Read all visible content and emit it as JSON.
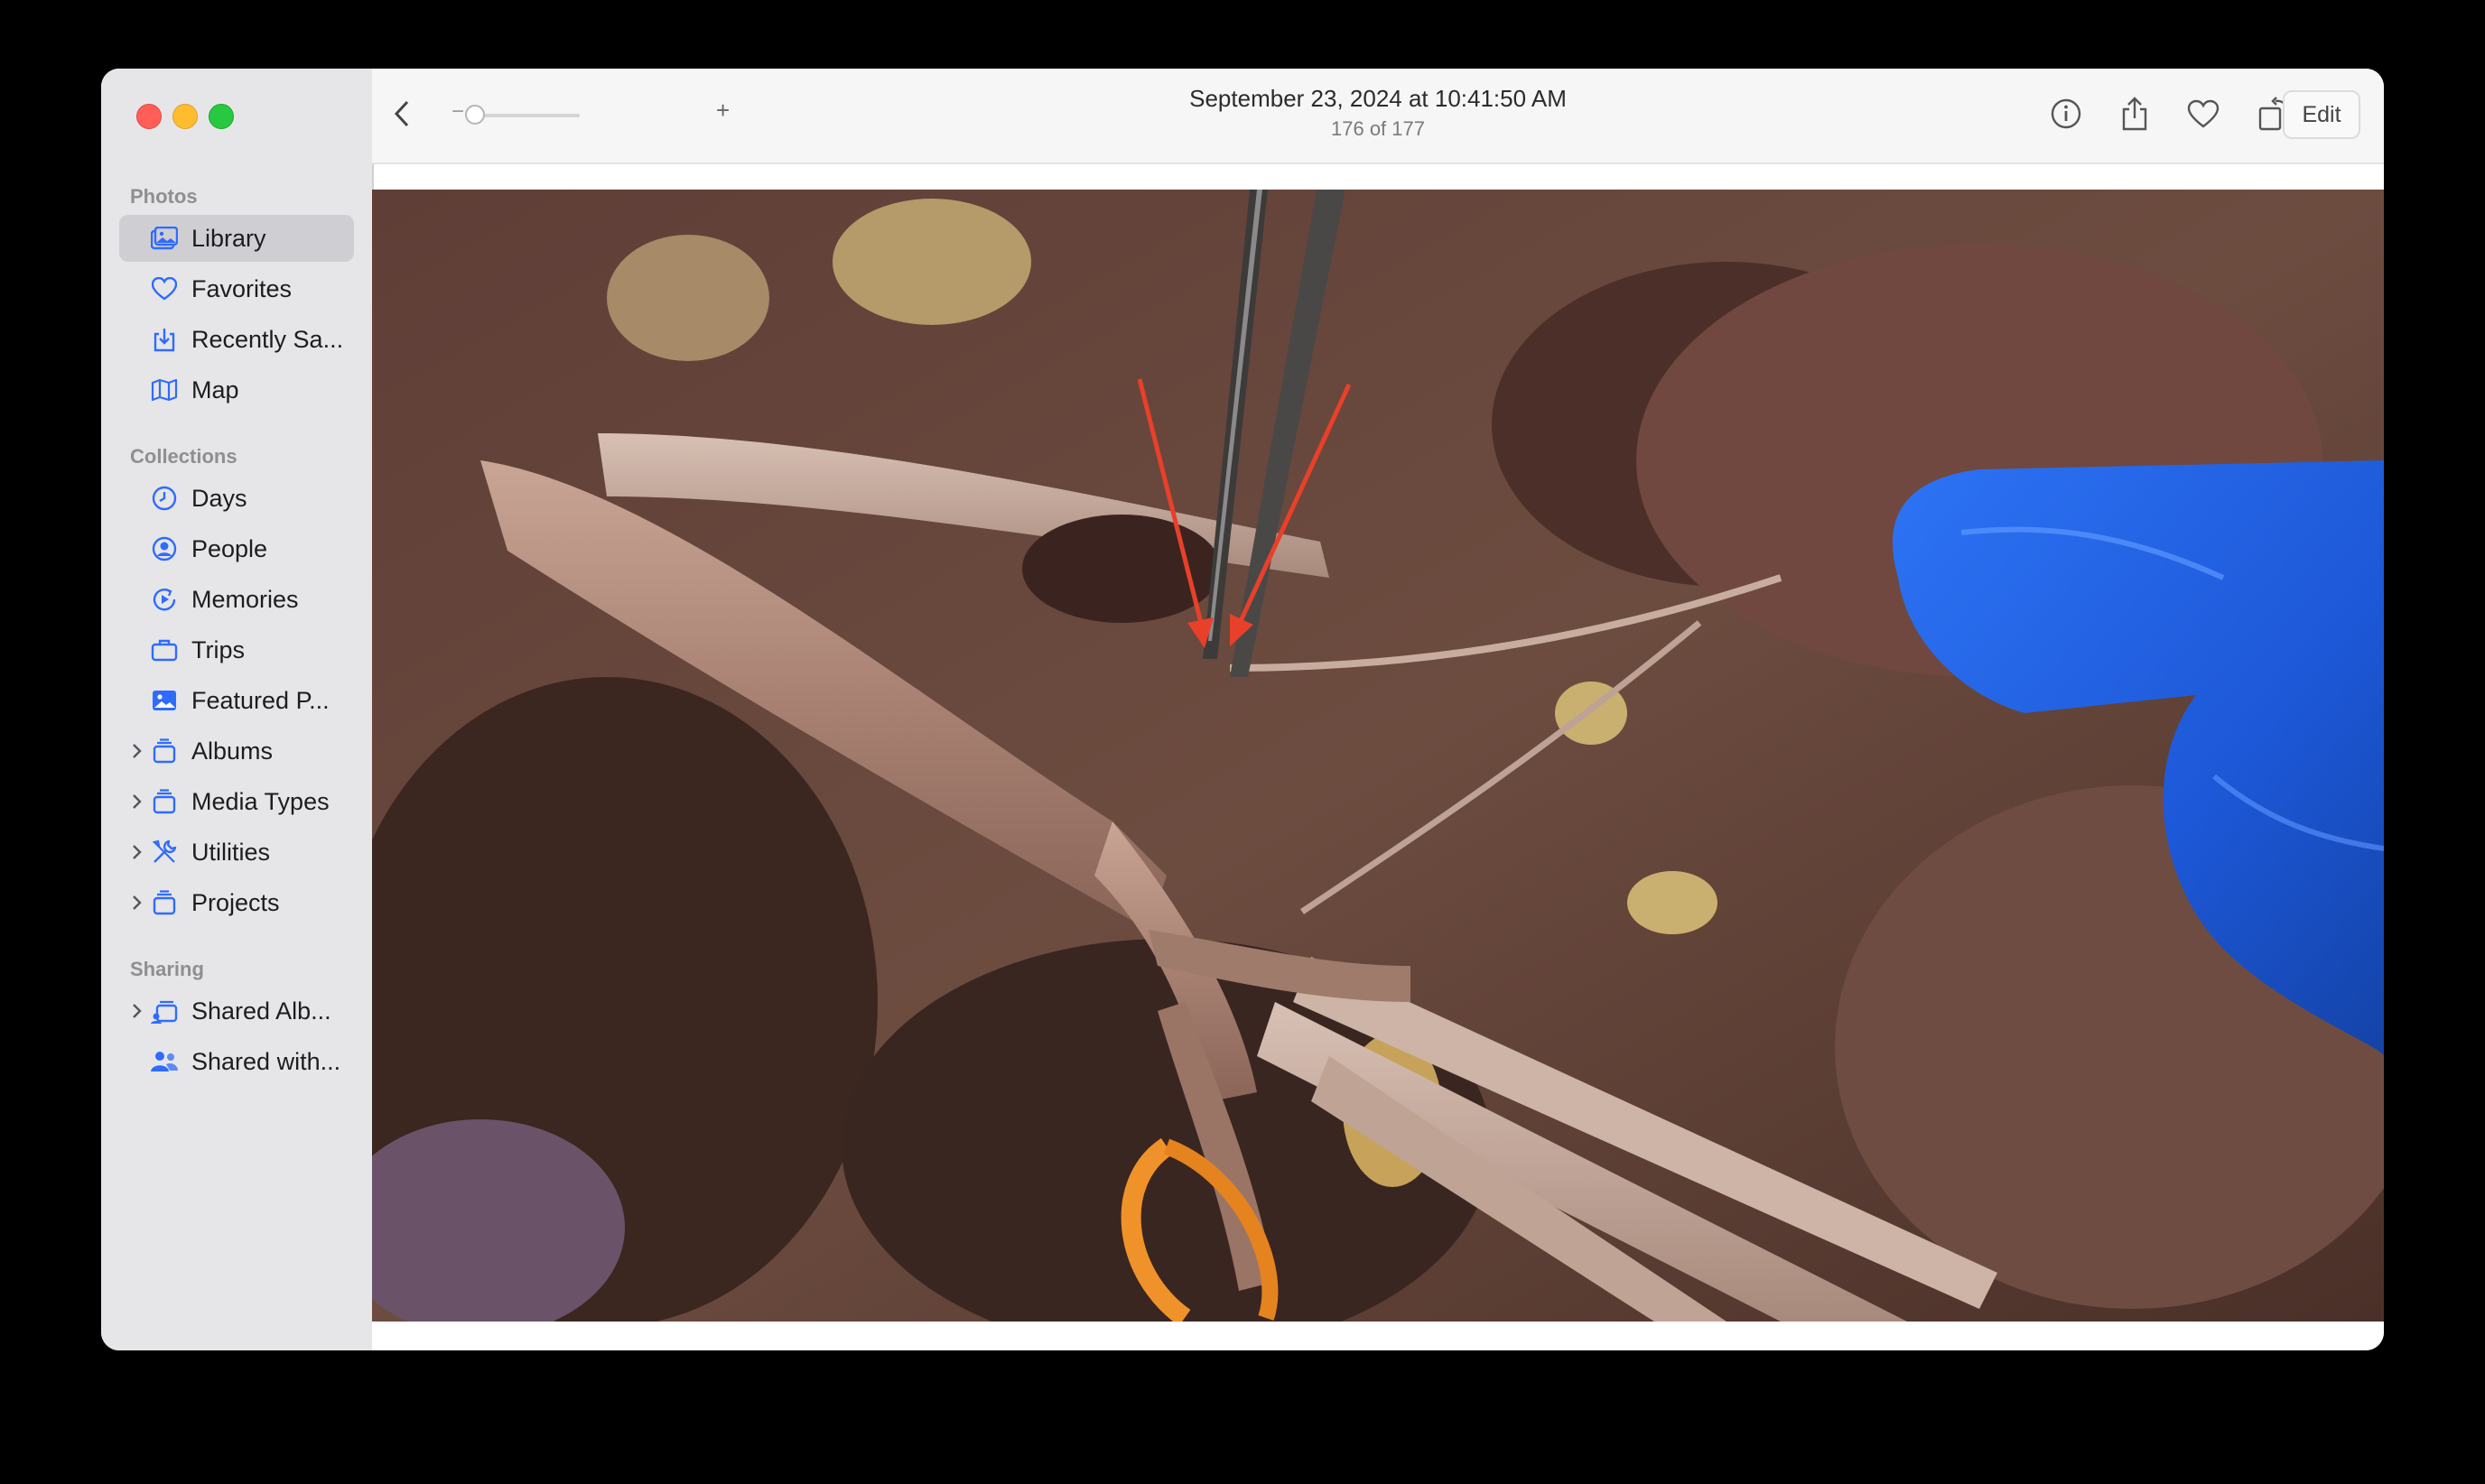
{
  "sidebar": {
    "sections": {
      "photos": "Photos",
      "collections": "Collections",
      "sharing": "Sharing"
    },
    "items": [
      {
        "label": "Library",
        "icon": "photo-library-icon"
      },
      {
        "label": "Favorites",
        "icon": "heart-icon"
      },
      {
        "label": "Recently Sa...",
        "icon": "download-tray-icon"
      },
      {
        "label": "Map",
        "icon": "map-icon"
      },
      {
        "label": "Days",
        "icon": "clock-icon"
      },
      {
        "label": "People",
        "icon": "person-circle-icon"
      },
      {
        "label": "Memories",
        "icon": "memories-icon"
      },
      {
        "label": "Trips",
        "icon": "suitcase-icon"
      },
      {
        "label": "Featured P...",
        "icon": "featured-photo-icon"
      },
      {
        "label": "Albums",
        "icon": "stack-icon"
      },
      {
        "label": "Media Types",
        "icon": "stack-icon"
      },
      {
        "label": "Utilities",
        "icon": "tools-icon"
      },
      {
        "label": "Projects",
        "icon": "stack-icon"
      },
      {
        "label": "Shared Alb...",
        "icon": "shared-album-icon"
      },
      {
        "label": "Shared with...",
        "icon": "people-icon"
      }
    ]
  },
  "toolbar": {
    "title": "September 23, 2024 at 10:41:50 AM",
    "subtitle": "176 of 177",
    "zoom_minus": "−",
    "zoom_plus": "+",
    "zoom_level": 0.0,
    "edit_label": "Edit"
  },
  "colors": {
    "accent": "#2f6bff",
    "arrow": "#e8402a",
    "glove": "#1f5fe0"
  }
}
